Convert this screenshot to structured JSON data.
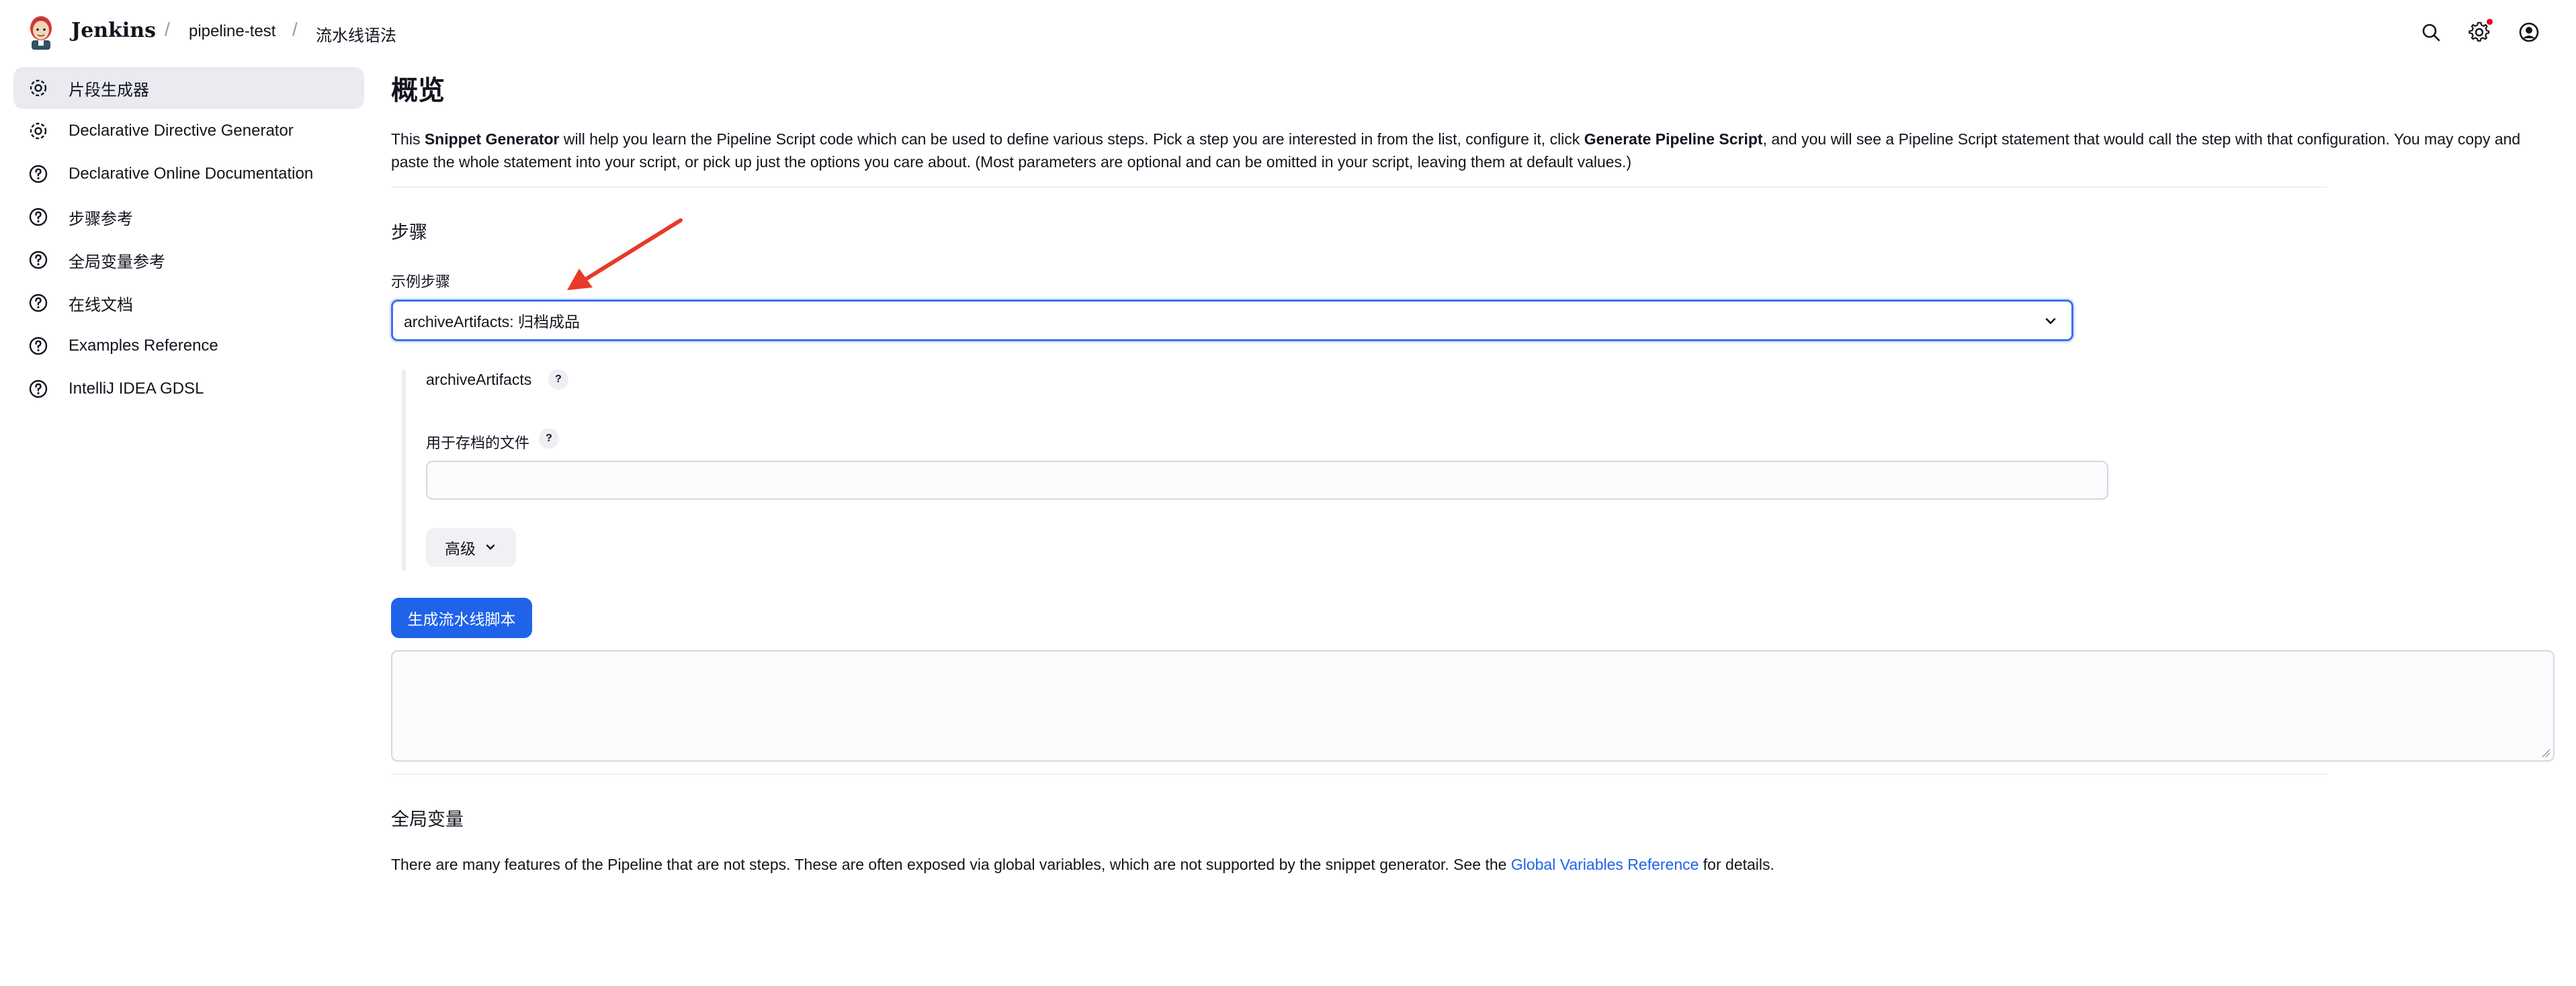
{
  "header": {
    "brand": "Jenkins",
    "breadcrumbs": [
      "pipeline-test",
      "流水线语法"
    ],
    "icons": [
      "search-icon",
      "gear-icon",
      "user-icon"
    ]
  },
  "sidebar": {
    "items": [
      {
        "label": "片段生成器",
        "icon": "gear-icon",
        "active": true
      },
      {
        "label": "Declarative Directive Generator",
        "icon": "gear-icon"
      },
      {
        "label": "Declarative Online Documentation",
        "icon": "help-circle-icon"
      },
      {
        "label": "步骤参考",
        "icon": "help-circle-icon"
      },
      {
        "label": "全局变量参考",
        "icon": "help-circle-icon"
      },
      {
        "label": "在线文档",
        "icon": "help-circle-icon"
      },
      {
        "label": "Examples Reference",
        "icon": "help-circle-icon"
      },
      {
        "label": "IntelliJ IDEA GDSL",
        "icon": "help-circle-icon"
      }
    ]
  },
  "main": {
    "title": "概览",
    "intro": {
      "p1": "This ",
      "b1": "Snippet Generator",
      "p2": " will help you learn the Pipeline Script code which can be used to define various steps. Pick a step you are interested in from the list, configure it, click ",
      "b2": "Generate Pipeline Script",
      "p3": ", and you will see a Pipeline Script statement that would call the step with that configuration. You may copy and paste the whole statement into your script, or pick up just the options you care about. (Most parameters are optional and can be omitted in your script, leaving them at default values.)"
    },
    "steps_heading": "步骤",
    "sample_step_label": "示例步骤",
    "sample_step_value": "archiveArtifacts: 归档成品",
    "step_name": "archiveArtifacts",
    "help_glyph": "?",
    "files_label": "用于存档的文件",
    "files_value": "",
    "advanced_label": "高级",
    "generate_button": "生成流水线脚本",
    "script_output": "",
    "global_vars_heading": "全局变量",
    "global_vars_text": "There are many features of the Pipeline that are not steps. These are often exposed via global variables, which are not supported by the snippet generator. See the ",
    "global_vars_link": "Global Variables Reference",
    "global_vars_suffix": " for details."
  },
  "colors": {
    "accent": "#1f63e9",
    "annotation_arrow": "#e8392a",
    "notification_dot": "#e6001f"
  }
}
